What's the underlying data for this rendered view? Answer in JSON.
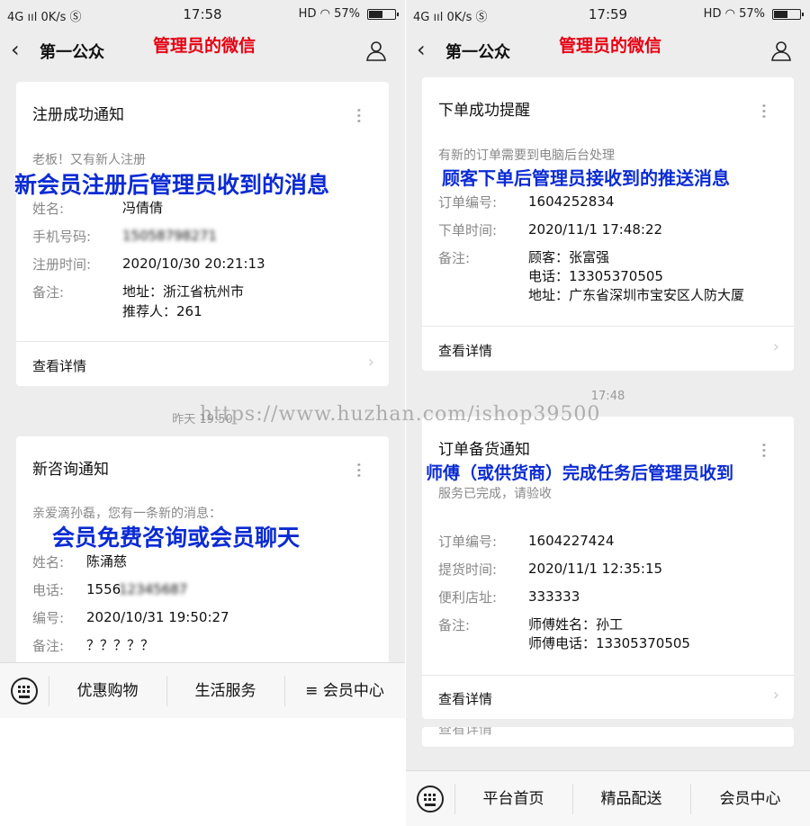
{
  "left": {
    "status": {
      "signal": "4G ııl",
      "speed": "0K/s",
      "time": "17:58",
      "hd": "HD",
      "battery": "57%",
      "battery_level": 0.57
    },
    "nav": {
      "title": "第一公众",
      "overlay_title": "管理员的微信"
    },
    "card1": {
      "title": "注册成功通知",
      "desc": "老板！又有新人注册",
      "overlay": "新会员注册后管理员收到的消息",
      "rows": [
        {
          "k": "姓名:",
          "v": "冯倩倩"
        },
        {
          "k": "手机号码:",
          "v": "15058798271"
        },
        {
          "k": "注册时间:",
          "v": "2020/10/30 20:21:13"
        },
        {
          "k": "备注:",
          "v": "地址：浙江省杭州市",
          "v2": "推荐人：261"
        }
      ],
      "detail": "查看详情"
    },
    "timestamp": "昨天 19:50",
    "card2": {
      "title": "新咨询通知",
      "desc": "亲爱滴孙磊，您有一条新的消息：",
      "overlay": "会员免费咨询或会员聊天",
      "rows": [
        {
          "k": "姓名:",
          "v": "陈涌慈"
        },
        {
          "k": "电话:",
          "v": "1556",
          "v_blur": "12345687"
        },
        {
          "k": "编号:",
          "v": "2020/10/31 19:50:27"
        },
        {
          "k": "备注:",
          "v": "？？？？？"
        }
      ]
    },
    "menu": {
      "item1": "优惠购物",
      "item2": "生活服务",
      "item3": "≡ 会员中心"
    }
  },
  "right": {
    "status": {
      "signal": "4G ııl",
      "speed": "0K/s",
      "time": "17:59",
      "hd": "HD",
      "battery": "57%",
      "battery_level": 0.57
    },
    "nav": {
      "title": "第一公众",
      "overlay_title": "管理员的微信"
    },
    "card1": {
      "title": "下单成功提醒",
      "desc": "有新的订单需要到电脑后台处理",
      "overlay": "顾客下单后管理员接收到的推送消息",
      "rows": [
        {
          "k": "订单编号:",
          "v": "1604252834"
        },
        {
          "k": "下单时间:",
          "v": "2020/11/1 17:48:22"
        },
        {
          "k": "备注:",
          "v": "顾客：张富强",
          "v2": "电话：13305370505",
          "v3": "地址：广东省深圳市宝安区人防大厦"
        }
      ],
      "detail": "查看详情"
    },
    "timestamp": "17:48",
    "card2": {
      "title": "订单备货通知",
      "desc": "服务已完成，请验收",
      "overlay": "师傅（或供货商）完成任务后管理员收到",
      "rows": [
        {
          "k": "订单编号:",
          "v": "1604227424"
        },
        {
          "k": "提货时间:",
          "v": "2020/11/1 12:35:15"
        },
        {
          "k": "便利店址:",
          "v": "333333"
        },
        {
          "k": "备注:",
          "v": "师傅姓名：孙工",
          "v2": "师傅电话：13305370505"
        }
      ],
      "detail": "查看详情"
    },
    "card3_peek": "查看详情",
    "menu": {
      "item1": "平台首页",
      "item2": "精品配送",
      "item3": "会员中心"
    }
  },
  "watermark": "https://www.huzhan.com/ishop39500",
  "colors": {
    "overlay_red": "#e60012",
    "overlay_blue": "#0b2bd4",
    "chat_bg": "#ededed"
  }
}
